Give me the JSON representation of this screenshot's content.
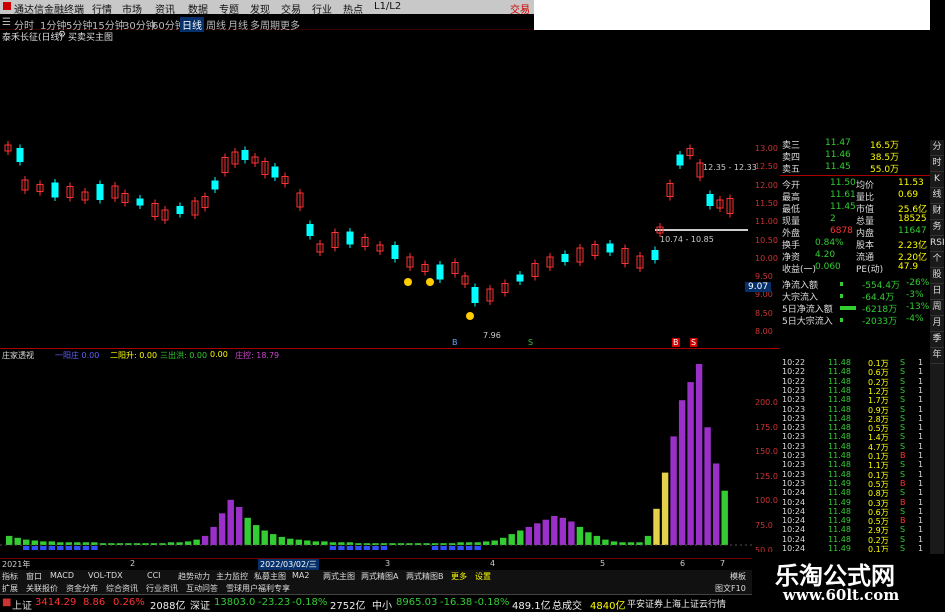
{
  "topbar": {
    "brand": "通达信金融终端",
    "menus": [
      "行情",
      "市场",
      "资讯",
      "数据",
      "专题",
      "发现",
      "交易",
      "行业",
      "热点",
      "L1/L2"
    ],
    "right": "交易"
  },
  "periods": [
    "分时",
    "1分钟",
    "5分钟",
    "15分钟",
    "30分钟",
    "60分钟",
    "日线",
    "周线",
    "月线",
    "多周期",
    "更多"
  ],
  "active_period": "日线",
  "title": {
    "stock": "泰禾长征(日线)",
    "indicator": "买卖买主图"
  },
  "kline_axis": [
    "13.00",
    "12.50",
    "12.00",
    "11.50",
    "11.00",
    "10.50",
    "10.00",
    "9.50",
    "9.00",
    "8.50",
    "8.00"
  ],
  "kline_annotations": {
    "high_label": "12.35 - 12.33",
    "mid_label": "10.74 - 10.85",
    "low_label": "7.96",
    "price_tag": "9.07",
    "marks": [
      "B",
      "S",
      "B",
      "S"
    ]
  },
  "quote": {
    "asks": [
      {
        "label": "卖三",
        "price": "11.47",
        "vol": "16.5万"
      },
      {
        "label": "卖四",
        "price": "11.46",
        "vol": "38.5万"
      },
      {
        "label": "卖五",
        "price": "11.45",
        "vol": "55.0万"
      }
    ],
    "rows": [
      {
        "a": "今开",
        "av": "11.50",
        "b": "均价",
        "bv": "11.53"
      },
      {
        "a": "最高",
        "av": "11.61",
        "b": "量比",
        "bv": "0.69"
      },
      {
        "a": "最低",
        "av": "11.45",
        "b": "市值",
        "bv": "25.6亿"
      },
      {
        "a": "现量",
        "av": "2",
        "b": "总量",
        "bv": "18525"
      },
      {
        "a": "外盘",
        "av": "6878",
        "b": "内盘",
        "bv": "11647"
      },
      {
        "a": "换手",
        "av": "0.84%",
        "b": "股本",
        "bv": "2.23亿"
      },
      {
        "a": "净资",
        "av": "4.20",
        "b": "流通",
        "bv": "2.20亿"
      },
      {
        "a": "收益(一)",
        "av": "0.060",
        "b": "PE(动)",
        "bv": "47.9"
      }
    ],
    "flows": [
      {
        "label": "净流入额",
        "value": "-554.4万",
        "pct": "-26%"
      },
      {
        "label": "大宗流入",
        "value": "-64.4万",
        "pct": "-3%"
      },
      {
        "label": "5日净流入额",
        "value": "-6218万",
        "pct": "-13%"
      },
      {
        "label": "5日大宗流入",
        "value": "-2033万",
        "pct": "-4%"
      }
    ]
  },
  "ticks": [
    {
      "t": "10:22",
      "p": "11.48",
      "v": "0.1万",
      "d": "S",
      "n": "1"
    },
    {
      "t": "10:22",
      "p": "11.48",
      "v": "0.6万",
      "d": "S",
      "n": "1"
    },
    {
      "t": "10:22",
      "p": "11.48",
      "v": "0.2万",
      "d": "S",
      "n": "1"
    },
    {
      "t": "10:23",
      "p": "11.48",
      "v": "1.2万",
      "d": "S",
      "n": "1"
    },
    {
      "t": "10:23",
      "p": "11.48",
      "v": "1.7万",
      "d": "S",
      "n": "1"
    },
    {
      "t": "10:23",
      "p": "11.48",
      "v": "0.9万",
      "d": "S",
      "n": "1"
    },
    {
      "t": "10:23",
      "p": "11.48",
      "v": "2.8万",
      "d": "S",
      "n": "1"
    },
    {
      "t": "10:23",
      "p": "11.48",
      "v": "0.5万",
      "d": "S",
      "n": "1"
    },
    {
      "t": "10:23",
      "p": "11.48",
      "v": "1.4万",
      "d": "S",
      "n": "1"
    },
    {
      "t": "10:23",
      "p": "11.48",
      "v": "4.7万",
      "d": "S",
      "n": "1"
    },
    {
      "t": "10:23",
      "p": "11.48",
      "v": "0.1万",
      "d": "B",
      "n": "1"
    },
    {
      "t": "10:23",
      "p": "11.48",
      "v": "1.1万",
      "d": "S",
      "n": "1"
    },
    {
      "t": "10:23",
      "p": "11.48",
      "v": "0.1万",
      "d": "S",
      "n": "1"
    },
    {
      "t": "10:23",
      "p": "11.49",
      "v": "0.5万",
      "d": "B",
      "n": "1"
    },
    {
      "t": "10:24",
      "p": "11.48",
      "v": "0.8万",
      "d": "S",
      "n": "1"
    },
    {
      "t": "10:24",
      "p": "11.49",
      "v": "0.3万",
      "d": "B",
      "n": "1"
    },
    {
      "t": "10:24",
      "p": "11.48",
      "v": "0.6万",
      "d": "S",
      "n": "1"
    },
    {
      "t": "10:24",
      "p": "11.49",
      "v": "0.5万",
      "d": "B",
      "n": "1"
    },
    {
      "t": "10:24",
      "p": "11.48",
      "v": "2.9万",
      "d": "S",
      "n": "1"
    },
    {
      "t": "10:24",
      "p": "11.48",
      "v": "0.2万",
      "d": "S",
      "n": "1"
    },
    {
      "t": "10:24",
      "p": "11.49",
      "v": "0.1万",
      "d": "S",
      "n": "1"
    }
  ],
  "indicator": {
    "name": "庄家透视",
    "labels": [
      {
        "text": "一阳庄 0.00",
        "color": "#6060ff"
      },
      {
        "text": "二阳升: 0.00",
        "color": "#ffff00"
      },
      {
        "text": "三出洪: 0.00",
        "color": "#33cc33"
      },
      {
        "text": "0.00",
        "color": "#ffff00"
      },
      {
        "text": "庄控: 18.79",
        "color": "#cc44cc"
      }
    ],
    "axis": [
      "200.0",
      "175.0",
      "150.0",
      "125.0",
      "100.0",
      "75.0",
      "50.0",
      "25.0"
    ]
  },
  "date_marker": "2022/03/02/三",
  "year_label": "2021年",
  "date_ticks": [
    "2",
    "3",
    "4",
    "5",
    "6",
    "7"
  ],
  "tabs": [
    "指标",
    "窗口",
    "MACD",
    "VOL-TDX",
    "CCI",
    "趋势动力",
    "主力监控",
    "私募主图",
    "MA2",
    "两式主图",
    "两式精图A",
    "两式精图B",
    "更多",
    "设置"
  ],
  "tabs_right": "模板",
  "tabs2": [
    "扩展",
    "关联报价",
    "资金分布",
    "综合资讯",
    "行业资讯",
    "互动问答",
    "雪球用户福利专享"
  ],
  "tabs2_right": "图文F10标",
  "side_icons": [
    "分",
    "时",
    "K",
    "线",
    "财",
    "务",
    "RSI",
    "个",
    "股",
    "日",
    "周",
    "月",
    "季",
    "年"
  ],
  "status": {
    "sh_name": "上证",
    "sh_val": "3414.29",
    "sh_chg": "8.86",
    "sh_pct": "0.26%",
    "sh_amt": "2088亿",
    "sz_name": "深证",
    "sz_val": "13803.0",
    "sz_chg": "-23.23",
    "sz_pct": "-0.18%",
    "sz_amt": "2752亿",
    "zx_name": "中小",
    "zx_val": "8965.03",
    "zx_chg": "-16.38",
    "zx_pct": "-0.18%",
    "zx_amt": "489.1亿",
    "total_label": "总成交",
    "total": "4840亿",
    "broker": "平安证券上海上证云行情"
  },
  "watermark": {
    "title": "乐淘公式网",
    "url": "www.60lt.com"
  },
  "chart_data": {
    "type": "bar",
    "title": "",
    "xlabel": "",
    "ylabel": "",
    "ylim": [
      0,
      200
    ],
    "series": [
      {
        "name": "庄控",
        "values": [
          10,
          8,
          6,
          5,
          4,
          4,
          3,
          3,
          3,
          3,
          3,
          2,
          2,
          2,
          2,
          2,
          2,
          2,
          2,
          3,
          3,
          4,
          6,
          10,
          20,
          35,
          50,
          42,
          30,
          22,
          16,
          12,
          9,
          7,
          6,
          5,
          4,
          4,
          3,
          3,
          3,
          2,
          2,
          2,
          2,
          2,
          2,
          2,
          2,
          2,
          2,
          2,
          2,
          3,
          3,
          3,
          4,
          5,
          8,
          12,
          16,
          20,
          24,
          28,
          32,
          30,
          26,
          20,
          14,
          10,
          6,
          4,
          3,
          3,
          3,
          10,
          40,
          80,
          120,
          160,
          180,
          200,
          130,
          90,
          60
        ]
      }
    ]
  }
}
